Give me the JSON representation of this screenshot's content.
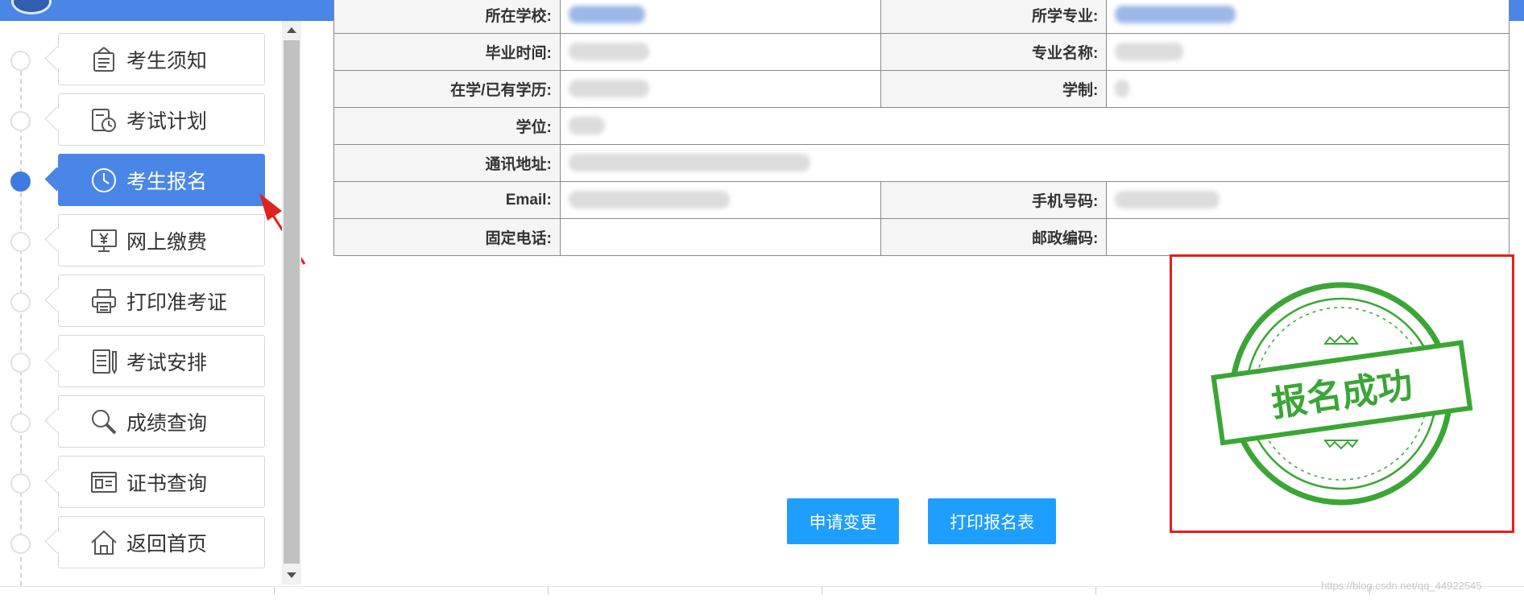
{
  "sidebar": {
    "items": [
      {
        "label": "考生须知",
        "icon": "notice-board-icon"
      },
      {
        "label": "考试计划",
        "icon": "calendar-clock-icon"
      },
      {
        "label": "考生报名",
        "icon": "clock-icon",
        "active": true
      },
      {
        "label": "网上缴费",
        "icon": "yen-monitor-icon"
      },
      {
        "label": "打印准考证",
        "icon": "printer-icon"
      },
      {
        "label": "考试安排",
        "icon": "document-pen-icon"
      },
      {
        "label": "成绩查询",
        "icon": "magnifier-icon"
      },
      {
        "label": "证书查询",
        "icon": "certificate-card-icon"
      },
      {
        "label": "返回首页",
        "icon": "home-icon"
      }
    ]
  },
  "table": {
    "rows": [
      {
        "left_label": "所在学校:",
        "right_label": "所学专业:"
      },
      {
        "left_label": "毕业时间:",
        "right_label": "专业名称:"
      },
      {
        "left_label": "在学/已有学历:",
        "right_label": "学制:"
      },
      {
        "single_label": "学位:"
      },
      {
        "single_label": "通讯地址:"
      },
      {
        "left_label": "Email:",
        "right_label": "手机号码:"
      },
      {
        "left_label": "固定电话:",
        "right_label": "邮政编码:"
      }
    ]
  },
  "buttons": {
    "apply_change": "申请变更",
    "print_form": "打印报名表"
  },
  "stamp": {
    "text": "报名成功",
    "color": "#3aa635"
  },
  "watermark": "https://blog.csdn.net/qq_44922545",
  "colors": {
    "topbar": "#4a86e8",
    "active": "#4a86e8",
    "button": "#1e9fff",
    "highlight_box": "#e0221e"
  }
}
